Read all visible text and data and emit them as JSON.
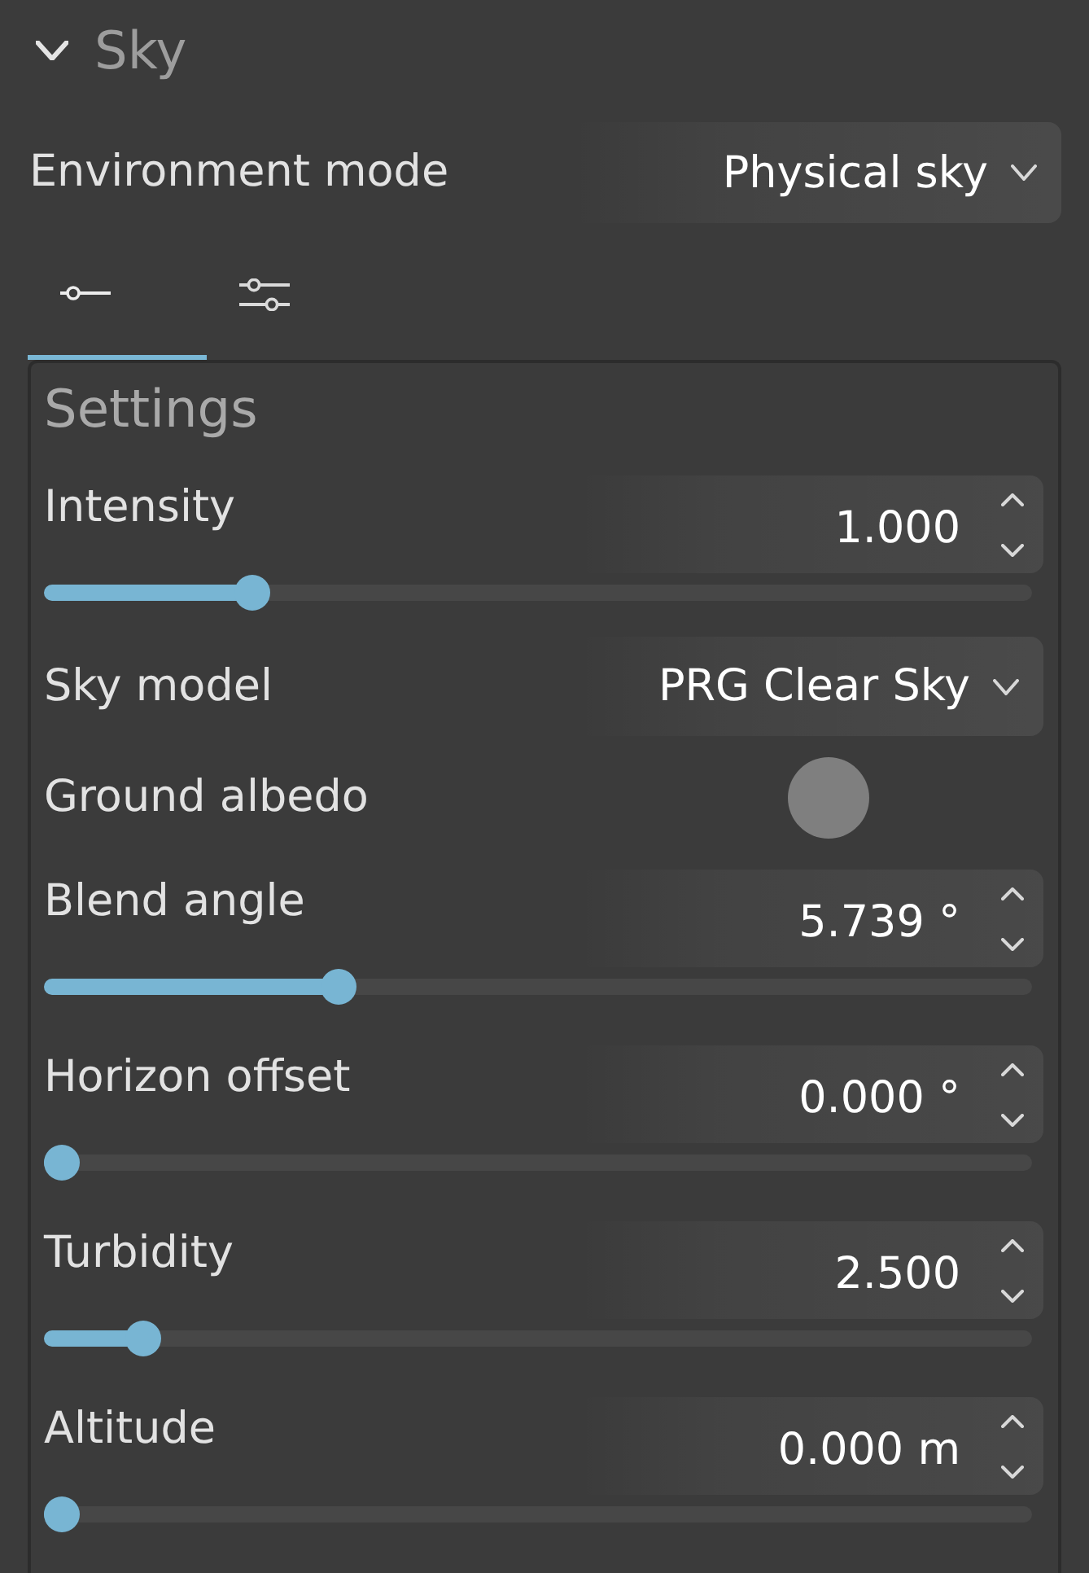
{
  "section": {
    "title": "Sky",
    "expanded": true
  },
  "environment_mode": {
    "label": "Environment mode",
    "value": "Physical sky"
  },
  "tabs": [
    {
      "kind": "basic",
      "selected": true
    },
    {
      "kind": "advanced",
      "selected": false
    }
  ],
  "settings": {
    "title": "Settings",
    "rows": [
      {
        "kind": "slider",
        "label": "Intensity",
        "value": "1.000",
        "level": 0.2
      },
      {
        "kind": "dropdown",
        "label": "Sky model",
        "value": "PRG Clear Sky"
      },
      {
        "kind": "color",
        "label": "Ground albedo",
        "color": "#7f7f7f"
      },
      {
        "kind": "slider",
        "label": "Blend angle",
        "value": "5.739 °",
        "level": 0.29
      },
      {
        "kind": "slider",
        "label": "Horizon offset",
        "value": "0.000 °",
        "level": 0
      },
      {
        "kind": "slider",
        "label": "Turbidity",
        "value": "2.500",
        "level": 0.085
      },
      {
        "kind": "slider",
        "label": "Altitude",
        "value": "0.000 m",
        "level": 0
      }
    ]
  }
}
